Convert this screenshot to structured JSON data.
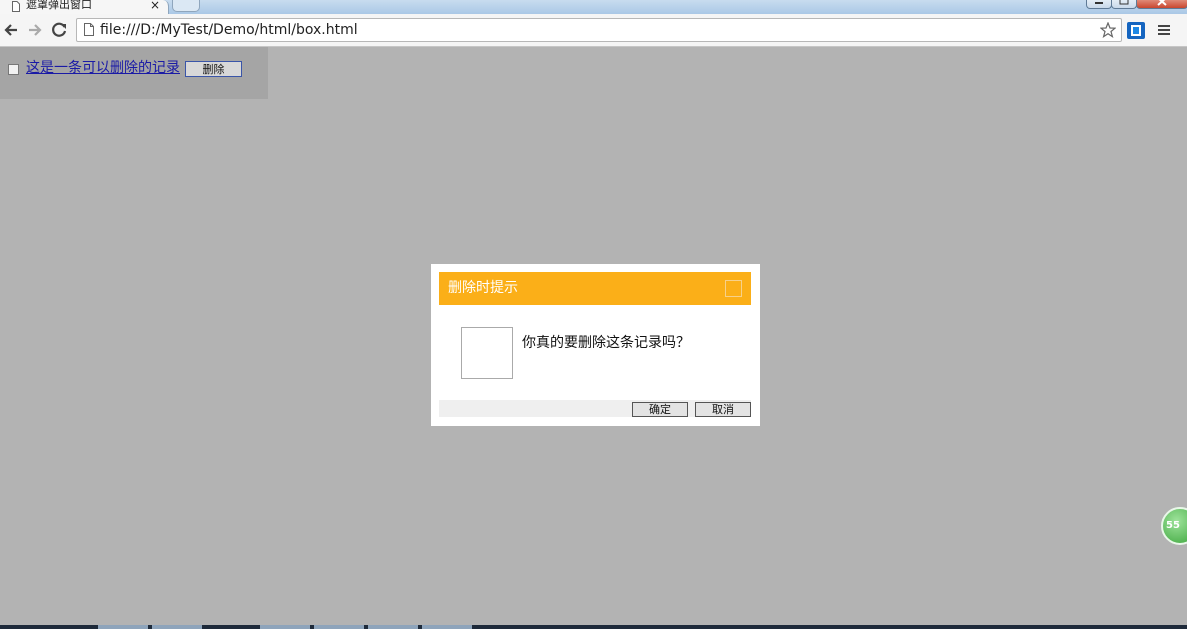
{
  "browser": {
    "tab_title": "遮罩弹出窗口",
    "tab_close": "×",
    "url": "file:///D:/MyTest/Demo/html/box.html"
  },
  "page": {
    "record_link": "这是一条可以删除的记录",
    "delete_button": "删除"
  },
  "dialog": {
    "title": "删除时提示",
    "message": "你真的要删除这条记录吗？",
    "ok_button": "确定",
    "cancel_button": "取消"
  },
  "badge": {
    "label": "55"
  },
  "colors": {
    "dialog_header": "#fbaf18",
    "overlay": "#b3b3b3"
  }
}
